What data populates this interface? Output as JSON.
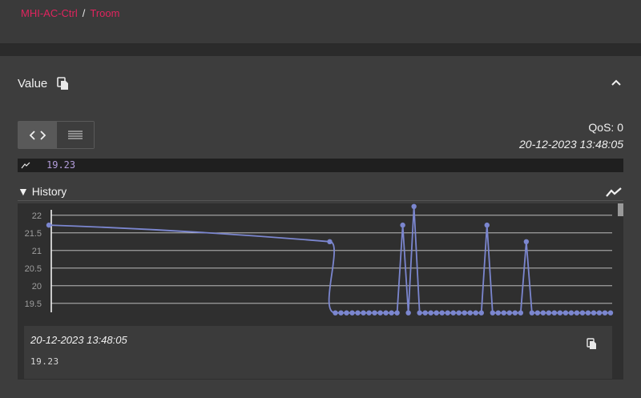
{
  "breadcrumb": {
    "items": [
      "MHI-AC-Ctrl",
      "Troom"
    ],
    "separator": "/"
  },
  "value_section": {
    "title": "Value",
    "qos": "QoS: 0",
    "timestamp": "20-12-2023 13:48:05",
    "current_value": "19.23"
  },
  "history": {
    "label": "▼ History",
    "detail_timestamp": "20-12-2023 13:48:05",
    "detail_value": "19.23"
  },
  "colors": {
    "accent": "#e0245e",
    "series": "#7b86cf",
    "value_text": "#b39ddb"
  },
  "chart_data": {
    "type": "line",
    "yticks": [
      "22",
      "21.5",
      "21",
      "20.5",
      "20",
      "19.5"
    ],
    "ylim": [
      19.2,
      22.2
    ],
    "grid": true,
    "x": [
      0,
      50,
      51,
      52,
      53,
      54,
      55,
      56,
      57,
      58,
      59,
      60,
      61,
      62,
      63,
      64,
      65,
      66,
      67,
      68,
      69,
      70,
      71,
      72,
      73,
      74,
      75,
      76,
      77,
      78,
      79,
      80,
      81,
      82,
      83,
      84,
      85,
      86,
      87,
      88,
      89,
      90,
      91,
      92,
      93,
      94,
      95,
      96,
      97,
      98,
      99,
      100
    ],
    "values": [
      21.72,
      21.25,
      19.23,
      19.23,
      19.23,
      19.23,
      19.23,
      19.23,
      19.23,
      19.23,
      19.23,
      19.23,
      19.23,
      19.23,
      21.72,
      19.23,
      22.25,
      19.23,
      19.23,
      19.23,
      19.23,
      19.23,
      19.23,
      19.23,
      19.23,
      19.23,
      19.23,
      19.23,
      19.23,
      21.72,
      19.23,
      19.23,
      19.23,
      19.23,
      19.23,
      19.23,
      21.25,
      19.23,
      19.23,
      19.23,
      19.23,
      19.23,
      19.23,
      19.23,
      19.23,
      19.23,
      19.23,
      19.23,
      19.23,
      19.23,
      19.23,
      19.23
    ]
  }
}
